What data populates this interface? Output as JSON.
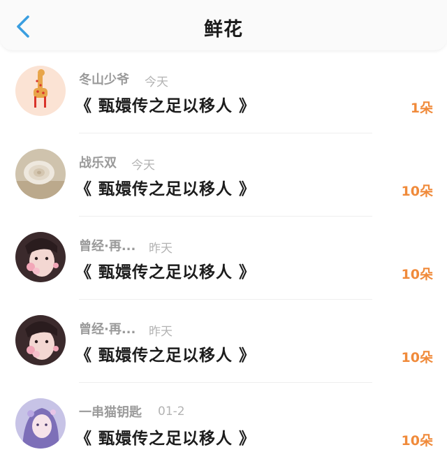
{
  "header": {
    "title": "鲜花",
    "back_icon": "chevron-left-icon",
    "accent_color": "#3a9ee0"
  },
  "accent": {
    "count_color": "#f08a3a"
  },
  "list": [
    {
      "user": "冬山少爷",
      "time": "今天",
      "book": "《 甄嬛传之足以移人 》",
      "count": "1朵",
      "avatar_icon": "giraffe-avatar"
    },
    {
      "user": "战乐双",
      "time": "今天",
      "book": "《 甄嬛传之足以移人 》",
      "count": "10朵",
      "avatar_icon": "seashell-avatar"
    },
    {
      "user": "曾经·再...",
      "time": "昨天",
      "book": "《 甄嬛传之足以移人 》",
      "count": "10朵",
      "avatar_icon": "illustrated-girl-avatar"
    },
    {
      "user": "曾经·再...",
      "time": "昨天",
      "book": "《 甄嬛传之足以移人 》",
      "count": "10朵",
      "avatar_icon": "illustrated-girl-avatar"
    },
    {
      "user": "一串猫钥匙",
      "time": "01-2",
      "book": "《 甄嬛传之足以移人 》",
      "count": "10朵",
      "avatar_icon": "anime-girl-avatar"
    }
  ]
}
